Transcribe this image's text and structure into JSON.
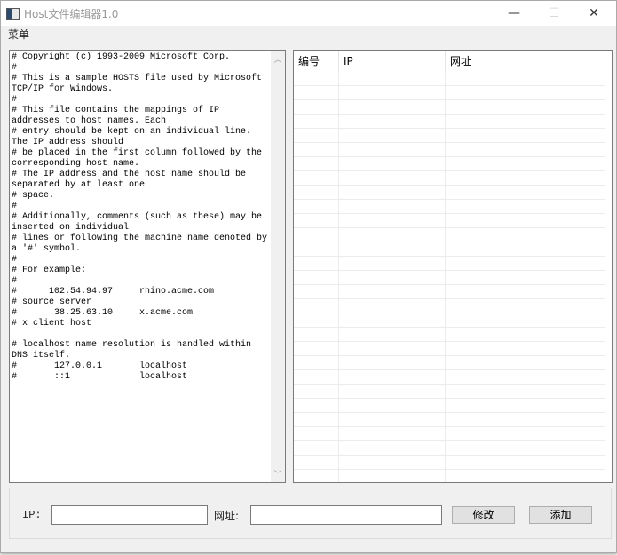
{
  "window": {
    "title": "Host文件编辑器1.0",
    "minimize": "—",
    "maximize": "☐",
    "close": "✕"
  },
  "menu": {
    "label": "菜单"
  },
  "editor": {
    "lines": [
      "# Copyright (c) 1993-2009 Microsoft Corp.",
      "#",
      "# This is a sample HOSTS file used by Microsoft",
      "TCP/IP for Windows.",
      "#",
      "# This file contains the mappings of IP",
      "addresses to host names. Each",
      "# entry should be kept on an individual line.",
      "The IP address should",
      "# be placed in the first column followed by the",
      "corresponding host name.",
      "# The IP address and the host name should be",
      "separated by at least one",
      "# space.",
      "#",
      "# Additionally, comments (such as these) may be",
      "inserted on individual",
      "# lines or following the machine name denoted by",
      "a '#' symbol.",
      "#",
      "# For example:",
      "#",
      "#      102.54.94.97     rhino.acme.com",
      "# source server",
      "#       38.25.63.10     x.acme.com",
      "# x client host",
      "",
      "# localhost name resolution is handled within",
      "DNS itself.",
      "#       127.0.0.1       localhost",
      "#       ::1             localhost"
    ],
    "scroll_up": "︿",
    "scroll_down": "﹀"
  },
  "table": {
    "columns": [
      "编号",
      "IP",
      "网址"
    ],
    "rows": []
  },
  "form": {
    "ip_label": "IP:",
    "ip_value": "",
    "url_label": "网址:",
    "url_value": "",
    "modify_button": "修改",
    "add_button": "添加"
  }
}
